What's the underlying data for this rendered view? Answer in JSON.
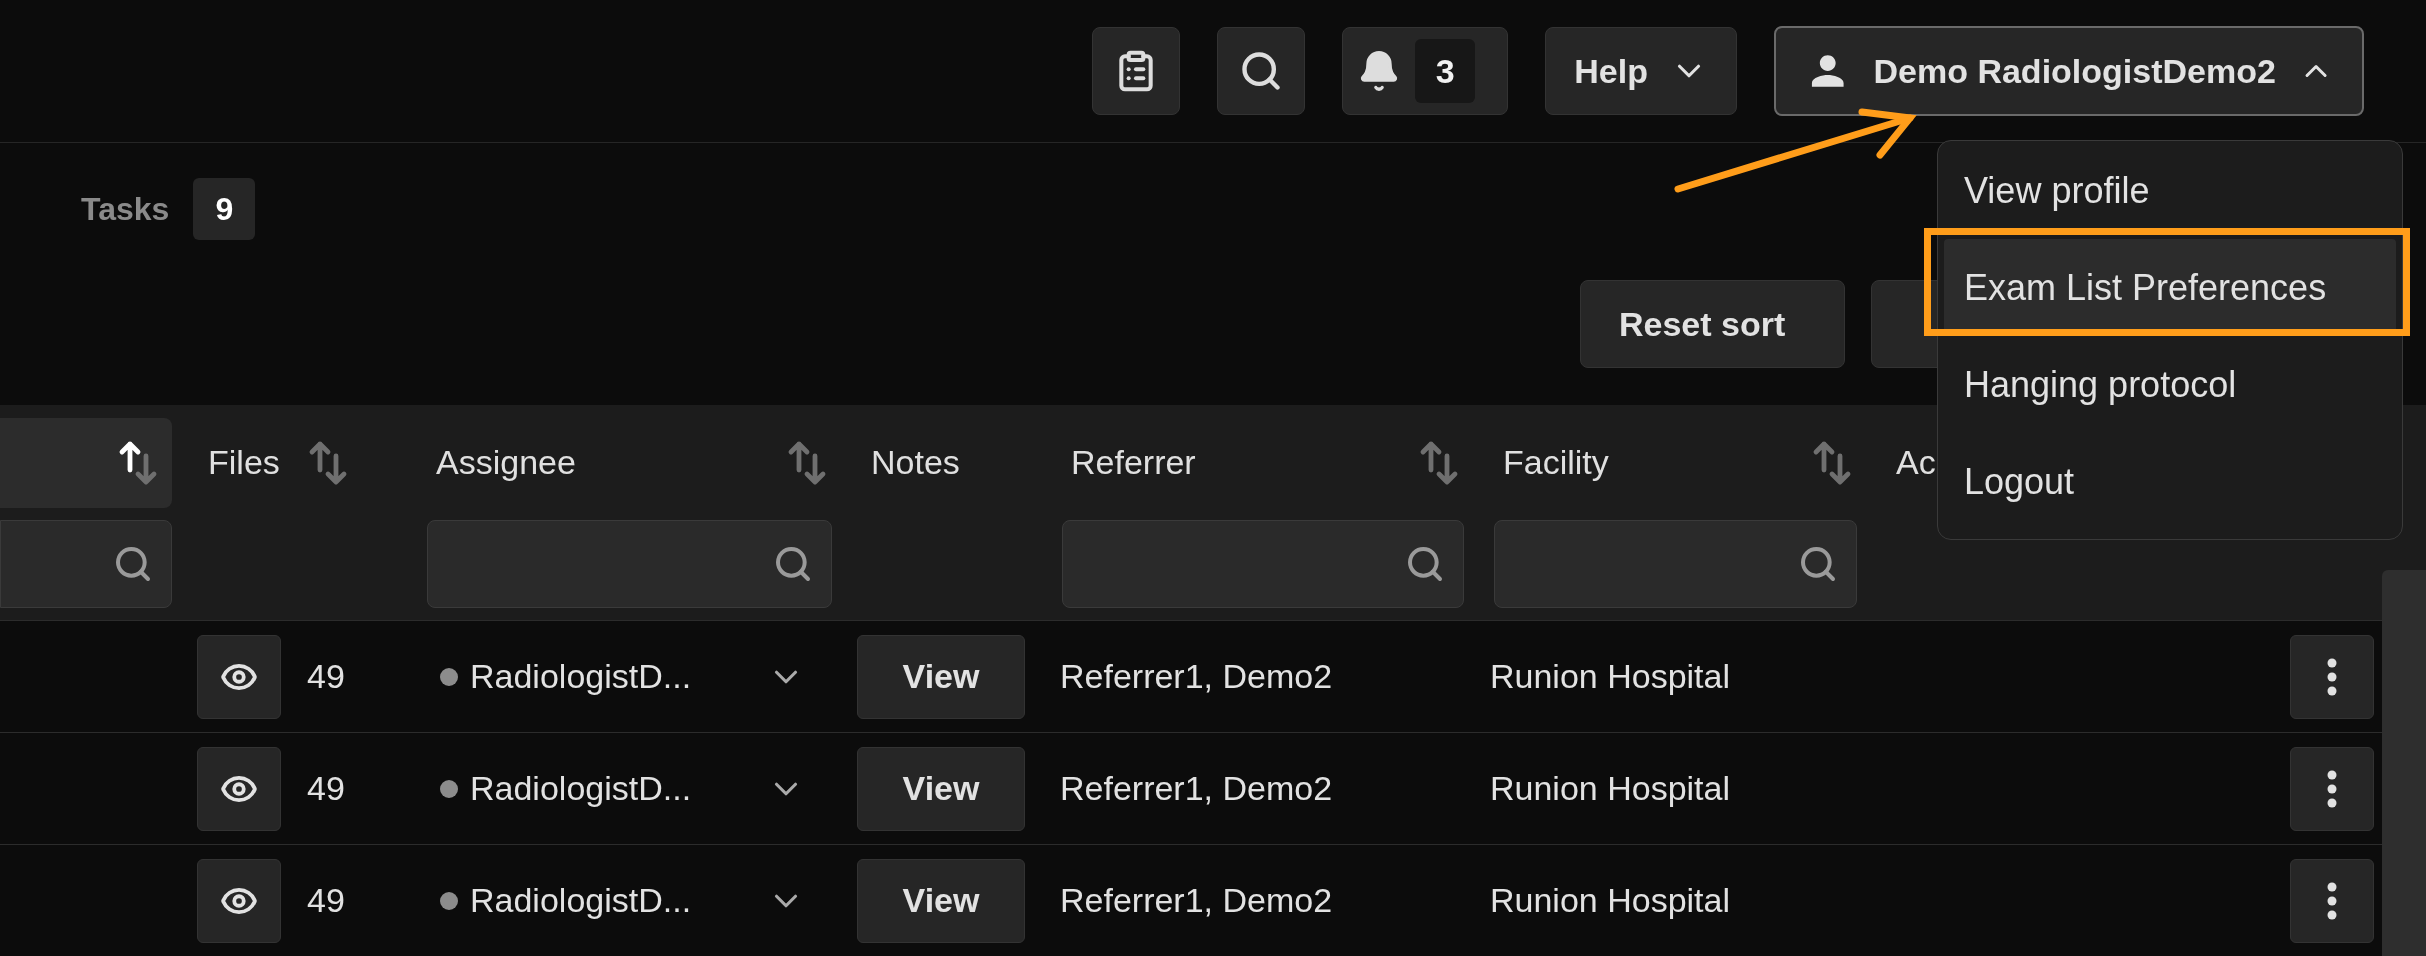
{
  "toolbar": {
    "notification_count": "3",
    "help": {
      "label": "Help",
      "expanded": false
    },
    "user": {
      "name": "Demo RadiologistDemo2",
      "expanded": true
    }
  },
  "tasks": {
    "label": "Tasks",
    "count": "9"
  },
  "actions": [
    "Reset sort"
  ],
  "table": {
    "columns": [
      {
        "sortable": true,
        "sorted": true,
        "filter": true
      },
      {
        "label": "Files",
        "sortable": true,
        "sorted": false
      },
      {
        "label": "Assignee",
        "sortable": true,
        "sorted": false,
        "filter": true
      },
      {
        "label": "Notes"
      },
      {
        "label": "Referrer",
        "sortable": true,
        "sorted": false,
        "filter": true
      },
      {
        "label": "Facility",
        "sortable": true,
        "sorted": false,
        "filter": true
      },
      {
        "label": "Ac"
      }
    ],
    "rows": [
      {
        "files": "49",
        "assignee": "RadiologistD...",
        "notes": "View",
        "referrer": "Referrer1, Demo2",
        "facility": "Runion Hospital"
      },
      {
        "files": "49",
        "assignee": "RadiologistD...",
        "notes": "View",
        "referrer": "Referrer1, Demo2",
        "facility": "Runion Hospital"
      },
      {
        "files": "49",
        "assignee": "RadiologistD...",
        "notes": "View",
        "referrer": "Referrer1, Demo2",
        "facility": "Runion Hospital"
      }
    ]
  },
  "user_menu": {
    "items": [
      {
        "label": "View profile",
        "selected": false,
        "annotated": false
      },
      {
        "label": "Exam List Preferences",
        "selected": true,
        "annotated": true
      },
      {
        "label": "Hanging protocol",
        "selected": false,
        "annotated": false
      },
      {
        "label": "Logout",
        "selected": false,
        "annotated": false
      }
    ]
  },
  "annotation": {
    "arrow": true
  }
}
